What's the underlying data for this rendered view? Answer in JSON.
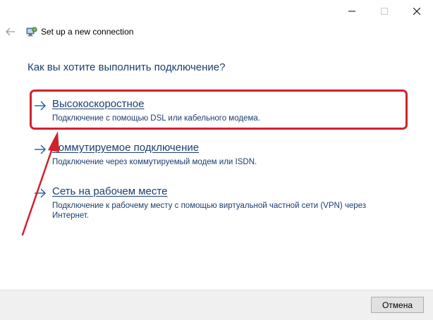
{
  "window": {
    "title": "Set up a new connection",
    "question": "Как вы хотите выполнить подключение?"
  },
  "options": [
    {
      "title": "Высокоскоростное",
      "description": "Подключение с помощью DSL или кабельного модема."
    },
    {
      "title": "Коммутируемое подключение",
      "description": "Подключение через коммутируемый модем или ISDN."
    },
    {
      "title": "Сеть на рабочем месте",
      "description": "Подключение к рабочему месту с помощью виртуальной частной сети (VPN) через Интернет."
    }
  ],
  "footer": {
    "cancel_label": "Отмена"
  },
  "icons": {
    "back": "back-arrow-icon",
    "app": "network-connection-icon",
    "option_arrow": "arrow-right-icon",
    "minimize": "minimize-icon",
    "maximize": "maximize-icon",
    "close": "close-icon"
  },
  "colors": {
    "link": "#1a3e6e",
    "annotation": "#d0212d",
    "footer_bg": "#f0f0f0"
  }
}
